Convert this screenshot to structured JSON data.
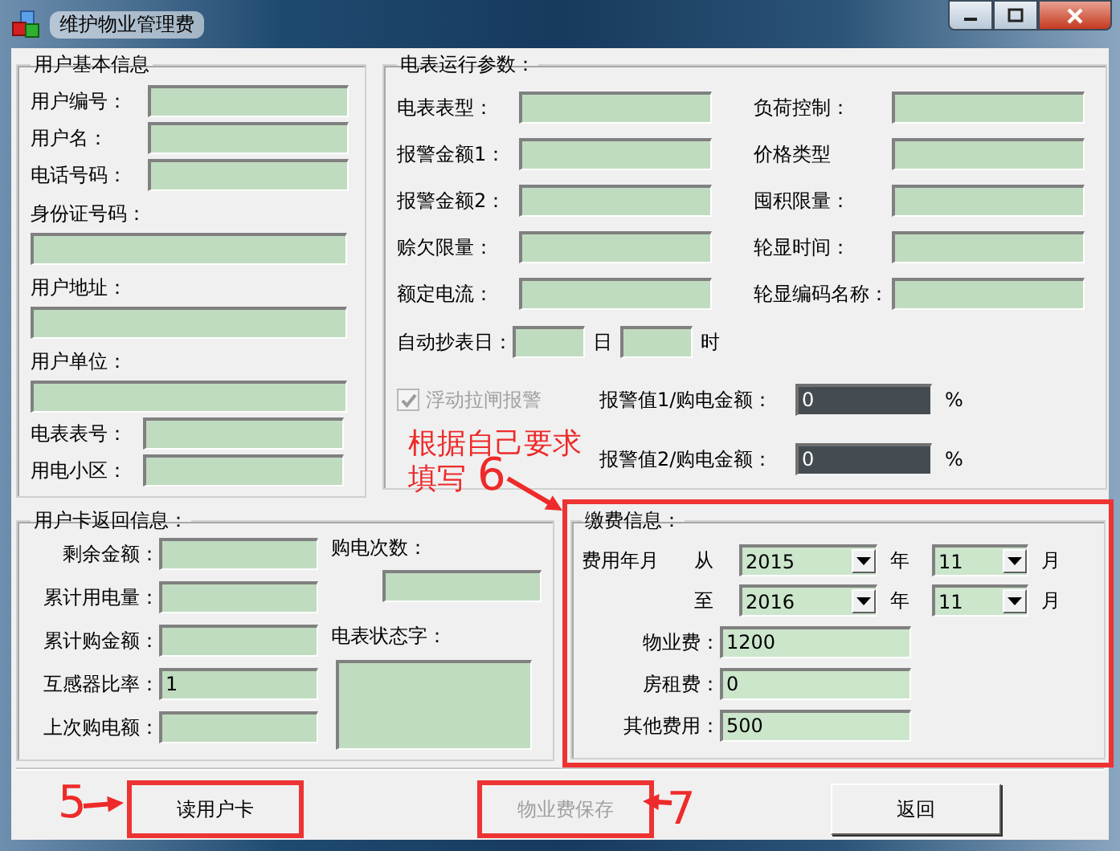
{
  "window": {
    "title": "维护物业管理费"
  },
  "user_info": {
    "title": "用户基本信息",
    "fields": [
      {
        "label": "用户编号：",
        "kind": "inline"
      },
      {
        "label": "用户名：",
        "kind": "inline"
      },
      {
        "label": "电话号码：",
        "kind": "inline"
      },
      {
        "label": "身份证号码：",
        "kind": "stacked"
      },
      {
        "label": "用户地址：",
        "kind": "stacked"
      },
      {
        "label": "用户单位：",
        "kind": "stacked"
      },
      {
        "label": "电表表号：",
        "kind": "inline"
      },
      {
        "label": "用电小区：",
        "kind": "inline"
      }
    ]
  },
  "meter_params": {
    "title": "电表运行参数：",
    "fields": [
      {
        "label": "电表表型："
      },
      {
        "label": "负荷控制："
      },
      {
        "label": "报警金额1："
      },
      {
        "label": "价格类型"
      },
      {
        "label": "报警金额2："
      },
      {
        "label": "囤积限量："
      },
      {
        "label": "赊欠限量："
      },
      {
        "label": "轮显时间："
      },
      {
        "label": "额定电流："
      },
      {
        "label": "轮显编码名称："
      }
    ],
    "auto_read": {
      "label": "自动抄表日：",
      "day_unit": "日",
      "hour_unit": "时"
    },
    "float_alarm": {
      "label": "浮动拉闸报警",
      "checked": true,
      "disabled": true
    },
    "alarm_ratios": [
      {
        "label": "报警值1/购电金额：",
        "value": "0",
        "unit": "%"
      },
      {
        "label": "报警值2/购电金额：",
        "value": "0",
        "unit": "%"
      }
    ]
  },
  "card_info": {
    "title": "用户卡返回信息：",
    "fields": [
      {
        "label": "剩余金额："
      },
      {
        "label": "累计用电量："
      },
      {
        "label": "累计购金额："
      },
      {
        "label": "互感器比率：",
        "value": "1"
      },
      {
        "label": "上次购电额："
      }
    ],
    "purchase_count": {
      "label": "购电次数："
    },
    "status_word": {
      "label": "电表状态字："
    }
  },
  "payment": {
    "title": "缴费信息：",
    "highlighted": true,
    "period_label": "费用年月",
    "ranges": [
      {
        "label": "从",
        "year": "2015",
        "year_unit": "年",
        "month": "11",
        "month_unit": "月"
      },
      {
        "label": "至",
        "year": "2016",
        "year_unit": "年",
        "month": "11",
        "month_unit": "月"
      }
    ],
    "fees": [
      {
        "label": "物业费：",
        "value": "1200"
      },
      {
        "label": "房租费：",
        "value": "0"
      },
      {
        "label": "其他费用：",
        "value": "500"
      }
    ]
  },
  "buttons": [
    {
      "label": "读用户卡",
      "disabled": false,
      "highlighted": true
    },
    {
      "label": "物业费保存",
      "disabled": true,
      "highlighted": true
    },
    {
      "label": "返回",
      "disabled": false,
      "highlighted": false
    }
  ],
  "annotations": [
    {
      "kind": "step",
      "text": "5"
    },
    {
      "kind": "note",
      "text": "根据自己要求"
    },
    {
      "kind": "note",
      "text": "填写"
    },
    {
      "kind": "step",
      "text": "6"
    },
    {
      "kind": "step",
      "text": "7"
    }
  ]
}
